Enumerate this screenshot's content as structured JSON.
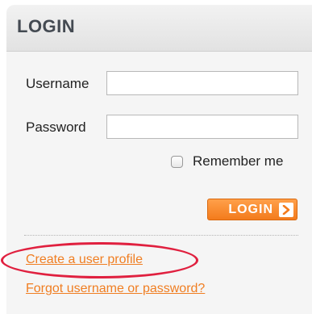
{
  "panel": {
    "title": "LOGIN"
  },
  "form": {
    "username_label": "Username",
    "username_value": "",
    "password_label": "Password",
    "password_value": "",
    "remember_label": "Remember me",
    "remember_checked": false,
    "login_button_label": "LOGIN",
    "login_button_icon": "chevron-right-icon"
  },
  "links": {
    "create_profile": "Create a user profile",
    "forgot": "Forgot username or password?"
  },
  "colors": {
    "accent_orange": "#f37b1c",
    "link_orange": "#f07e22",
    "annotation_red": "#e0203f",
    "header_text": "#444a52"
  }
}
